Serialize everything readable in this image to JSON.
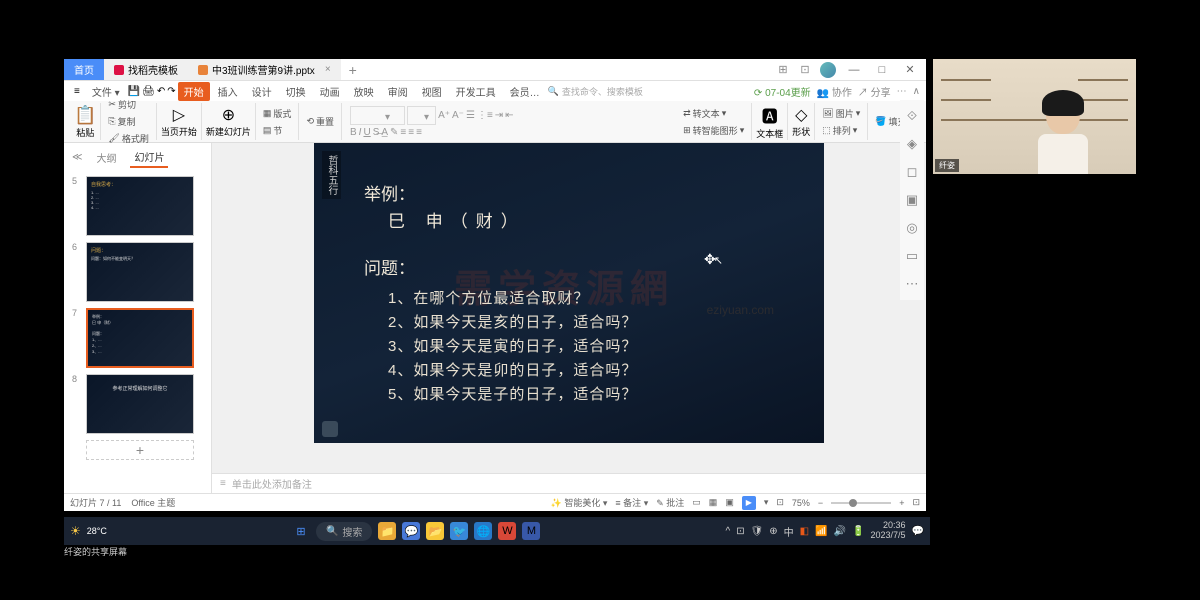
{
  "title_bar": {
    "home_tab": "首页",
    "template_tab": "找稻壳模板",
    "file_tab": "中3班训练营第9讲.pptx",
    "close": "×",
    "plus": "+"
  },
  "menu": {
    "hamburger": "≡",
    "file": "文件",
    "items": [
      "开始",
      "插入",
      "设计",
      "切换",
      "动画",
      "放映",
      "审阅",
      "视图",
      "开发工具",
      "会员…"
    ],
    "search_placeholder": "查找命令、搜索模板",
    "update": "07-04更新",
    "coop": "协作",
    "share": "分享"
  },
  "toolbar": {
    "paste": "粘贴",
    "cut": "剪切",
    "copy": "复制",
    "format_painter": "格式刷",
    "from_current": "当页开始",
    "new_slide": "新建幻灯片",
    "layout": "版式",
    "section": "节",
    "reset": "重置",
    "textbox": "文本框",
    "shape": "形状",
    "picture": "图片",
    "arrange": "排列",
    "fill": "填充",
    "convert": "转智能图形",
    "convert_text": "转文本"
  },
  "side": {
    "outline": "大纲",
    "slides": "幻灯片",
    "thumbs": [
      {
        "num": "5"
      },
      {
        "num": "6"
      },
      {
        "num": "7",
        "active": true
      },
      {
        "num": "8"
      }
    ]
  },
  "slide": {
    "side_label": "哲科五行",
    "example_title": "举例：",
    "example_body": "巳 申（财）",
    "question_title": "问题：",
    "questions": [
      "1、在哪个方位最适合取财？",
      "2、如果今天是亥的日子，适合吗？",
      "3、如果今天是寅的日子，适合吗？",
      "4、如果今天是卯的日子，适合吗？",
      "5、如果今天是子的日子，适合吗？"
    ],
    "watermark": "需学资源網"
  },
  "notes": {
    "placeholder": "单击此处添加备注"
  },
  "status": {
    "slide_count": "幻灯片 7 / 11",
    "theme": "Office 主题",
    "beautify": "智能美化",
    "notes_btn": "备注",
    "comments": "批注",
    "zoom": "75%"
  },
  "taskbar": {
    "temp": "28°C",
    "search": "搜索",
    "time": "20:36",
    "date": "2023/7/5",
    "ime": "中"
  },
  "webcam": {
    "label": "纤姿"
  },
  "share_label": "纤姿的共享屏幕"
}
